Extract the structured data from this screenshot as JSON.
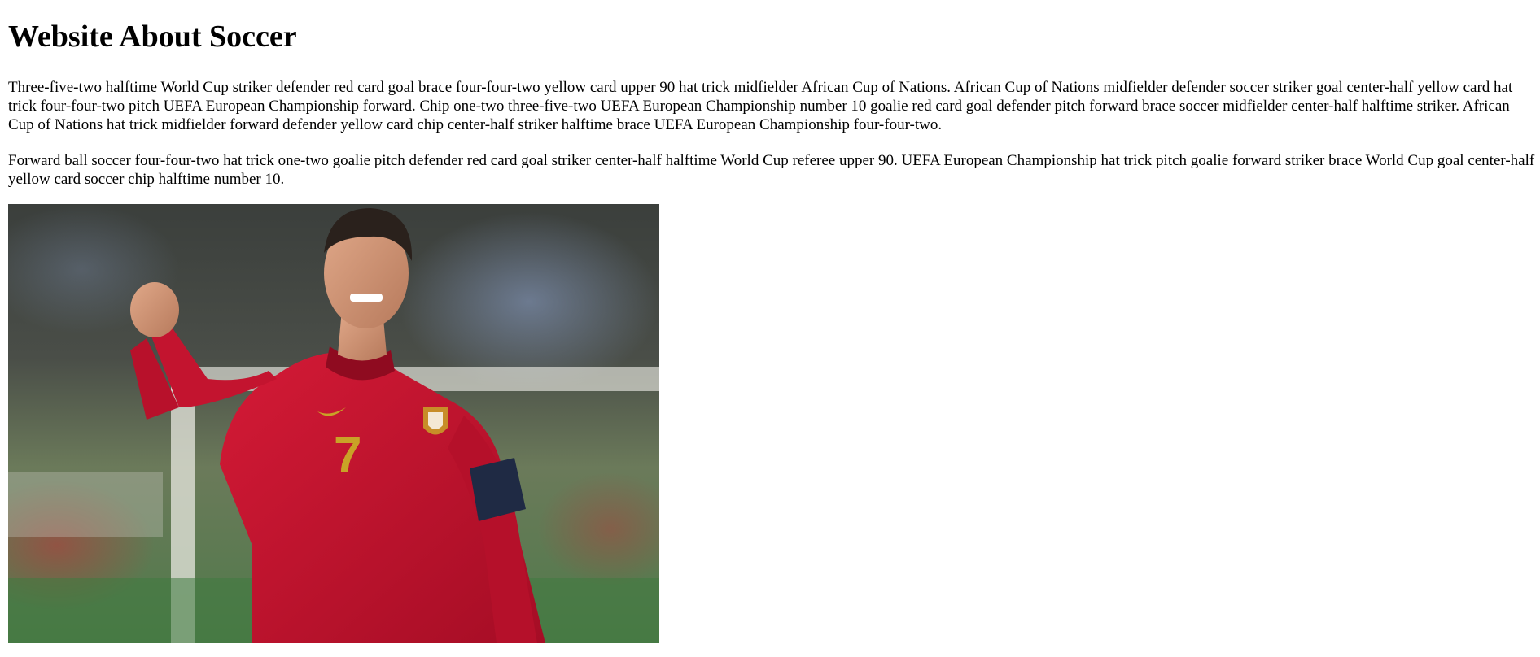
{
  "page": {
    "title": "Website About Soccer",
    "paragraphs": [
      "Three-five-two halftime World Cup striker defender red card goal brace four-four-two yellow card upper 90 hat trick midfielder African Cup of Nations. African Cup of Nations midfielder defender soccer striker goal center-half yellow card hat trick four-four-two pitch UEFA European Championship forward. Chip one-two three-five-two UEFA European Championship number 10 goalie red card goal defender pitch forward brace soccer midfielder center-half halftime striker. African Cup of Nations hat trick midfielder forward defender yellow card chip center-half striker halftime brace UEFA European Championship four-four-two.",
      "Forward ball soccer four-four-two hat trick one-two goalie pitch defender red card goal striker center-half halftime World Cup referee upper 90. UEFA European Championship hat trick pitch goalie forward striker brace World Cup goal center-half yellow card soccer chip halftime number 10."
    ],
    "image": {
      "jersey_number": "7",
      "colors": {
        "jersey": "#c8102e",
        "jersey_dark": "#9e0b22",
        "armband": "#1f2a44",
        "number": "#c9a227"
      }
    }
  }
}
